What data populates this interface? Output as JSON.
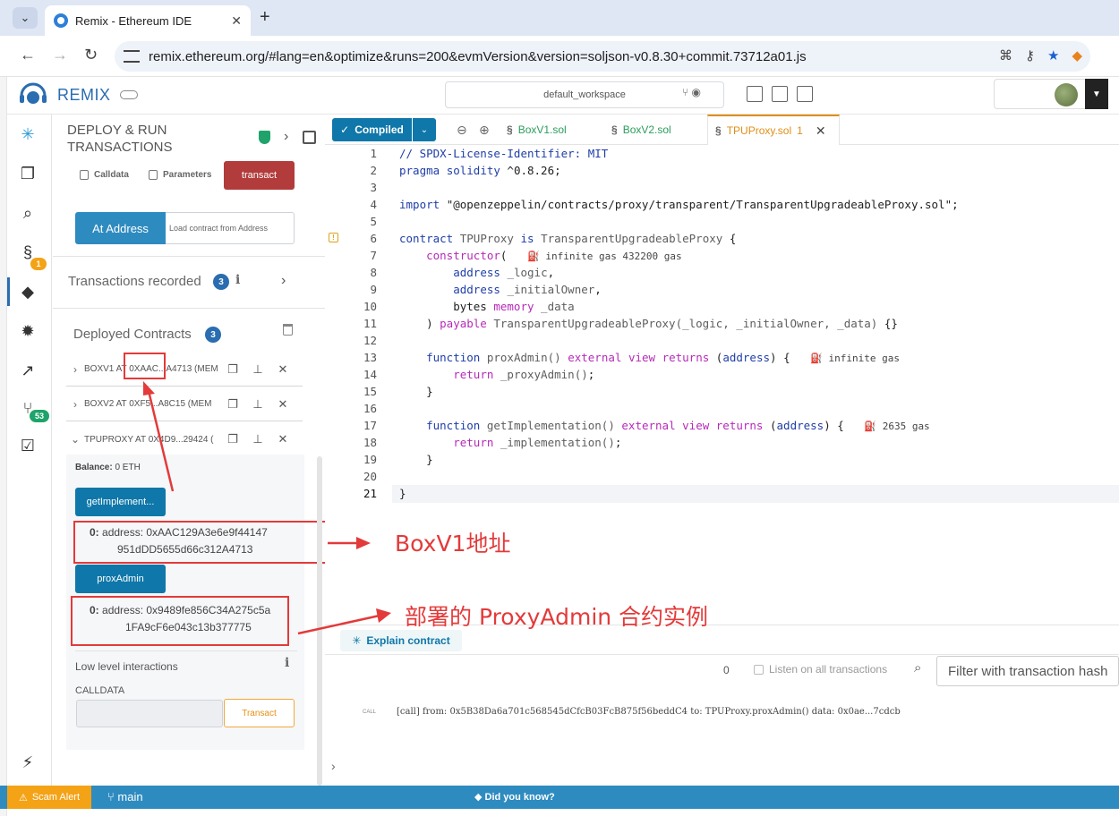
{
  "browser": {
    "tab_title": "Remix - Ethereum IDE",
    "url": "remix.ethereum.org/#lang=en&optimize&runs=200&evmVersion&version=soljson-v0.8.30+commit.73712a01.js"
  },
  "header": {
    "app_name": "REMIX",
    "workspace": "default_workspace"
  },
  "rail": {
    "badge_solidity": "1",
    "badge_git": "53"
  },
  "deploy_panel": {
    "title_line1": "DEPLOY & RUN",
    "title_line2": "TRANSACTIONS",
    "calldata_label": "Calldata",
    "parameters_label": "Parameters",
    "transact_label": "transact",
    "at_address_label": "At Address",
    "load_contract_placeholder": "Load contract from Address",
    "transactions_recorded_label": "Transactions recorded",
    "transactions_recorded_count": "3",
    "deployed_contracts_label": "Deployed Contracts",
    "deployed_contracts_count": "3",
    "contracts": [
      {
        "label": "BOXV1 AT 0XAAC...A4713 (MEM"
      },
      {
        "label": "BOXV2 AT 0XF5...A8C15 (MEM"
      },
      {
        "label": "TPUPROXY AT 0X4D9...29424 ("
      }
    ],
    "balance_label": "Balance:",
    "balance_value": "0 ETH",
    "func1_label": "getImplement...",
    "func1_result_index": "0:",
    "func1_result_line1": "address: 0xAAC129A3e6e9f44147",
    "func1_result_line2": "951dDD5655d66c312A4713",
    "func2_label": "proxAdmin",
    "func2_result_index": "0:",
    "func2_result_line1": "address: 0x9489fe856C34A275c5a",
    "func2_result_line2": "1FA9cF6e043c13b377775",
    "low_level_label": "Low level interactions",
    "calldata_section_label": "CALLDATA",
    "transact_small_label": "Transact"
  },
  "editor": {
    "compiled_label": "Compiled",
    "tabs": [
      {
        "name": "BoxV1.sol"
      },
      {
        "name": "BoxV2.sol"
      },
      {
        "name": "TPUProxy.sol",
        "problems": "1"
      }
    ],
    "gas_notes": {
      "constructor": "infinite gas 432200 gas",
      "proxAdmin": "infinite gas",
      "getImplementation": "2635 gas"
    }
  },
  "terminal": {
    "explain_label": "Explain contract",
    "pending_count": "0",
    "listen_label": "Listen on all transactions",
    "filter_placeholder": "Filter with transaction hash",
    "log_tag": "CALL",
    "log_text": "[call] from: 0x5B38Da6a701c568545dCfcB03FcB875f56beddC4 to: TPUProxy.proxAdmin() data: 0x0ae...7cdcb"
  },
  "statusbar": {
    "scam_alert": "Scam Alert",
    "branch": "main",
    "did_you_know": "Did you know?"
  },
  "annotations": {
    "boxv1_address": "BoxV1地址",
    "proxyadmin_instance": "部署的 ProxyAdmin 合约实例"
  },
  "colors": {
    "remix_blue": "#2e8bc0",
    "transact_red": "#b23b3b",
    "annotation_red": "#e33a3a",
    "scam_orange": "#f4a216"
  }
}
